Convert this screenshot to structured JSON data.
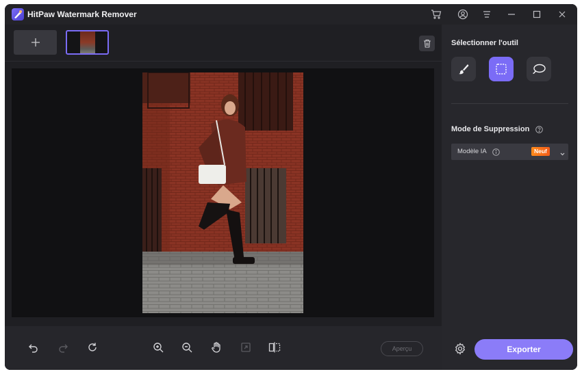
{
  "app": {
    "title": "HitPaw Watermark Remover"
  },
  "titlebar": {
    "icons": [
      "cart-icon",
      "account-icon",
      "menu-icon",
      "minimize-icon",
      "maximize-icon",
      "close-icon"
    ]
  },
  "media": {
    "add_icon": "plus-icon",
    "delete_icon": "trash-icon"
  },
  "bottom_bar": {
    "icons": [
      "undo-icon",
      "redo-icon",
      "reset-icon",
      "zoom-in-icon",
      "zoom-out-icon",
      "hand-pan-icon",
      "fit-screen-icon",
      "compare-split-icon"
    ],
    "preview_label": "Aperçu"
  },
  "sidebar": {
    "tool_section_title": "Sélectionner l'outil",
    "tools": [
      "brush-icon",
      "rectangle-select-icon",
      "lasso-icon"
    ],
    "active_tool": "rectangle-select-icon",
    "mode_section_title": "Mode de Suppression",
    "model_label": "Modèle IA",
    "model_badge": "Neuf",
    "export_label": "Exporter"
  },
  "colors": {
    "accent": "#7b6cf6",
    "export": "#8b7cf8",
    "badge": "#ff8a1a",
    "background": "#1f1f23",
    "panel": "#27272c"
  }
}
